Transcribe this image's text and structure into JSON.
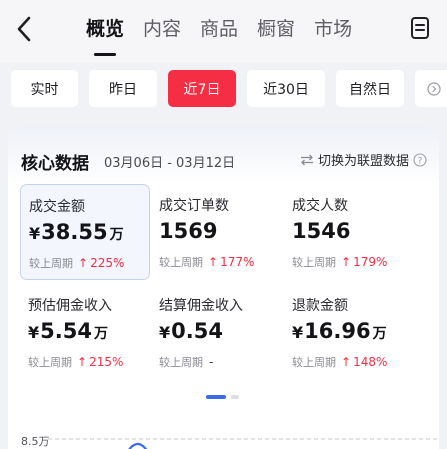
{
  "header": {
    "tabs": [
      {
        "label": "概览",
        "active": true
      },
      {
        "label": "内容",
        "active": false
      },
      {
        "label": "商品",
        "active": false
      },
      {
        "label": "橱窗",
        "active": false
      },
      {
        "label": "市场",
        "active": false
      }
    ]
  },
  "date_chips": [
    {
      "label": "实时"
    },
    {
      "label": "昨日"
    },
    {
      "label": "近7日",
      "active": true
    },
    {
      "label": "近30日"
    },
    {
      "label": "自然日"
    }
  ],
  "core": {
    "title": "核心数据",
    "range": "03月06日 - 03月12日",
    "switch_label": "切换为联盟数据"
  },
  "metrics": [
    {
      "label": "成交金额",
      "currency": "¥",
      "value": "38.55",
      "unit": "万",
      "compare_label": "较上周期",
      "arrow": "↑",
      "change": "225%",
      "selected": true
    },
    {
      "label": "成交订单数",
      "currency": "",
      "value": "1569",
      "unit": "",
      "compare_label": "较上周期",
      "arrow": "↑",
      "change": "177%"
    },
    {
      "label": "成交人数",
      "currency": "",
      "value": "1546",
      "unit": "",
      "compare_label": "较上周期",
      "arrow": "↑",
      "change": "179%"
    },
    {
      "label": "预估佣金收入",
      "currency": "¥",
      "value": "5.54",
      "unit": "万",
      "compare_label": "较上周期",
      "arrow": "↑",
      "change": "215%"
    },
    {
      "label": "结算佣金收入",
      "currency": "¥",
      "value": "0.54",
      "unit": "",
      "compare_label": "较上周期",
      "arrow": "",
      "change": "-"
    },
    {
      "label": "退款金额",
      "currency": "¥",
      "value": "16.96",
      "unit": "万",
      "compare_label": "较上周期",
      "arrow": "↑",
      "change": "148%"
    }
  ],
  "chart": {
    "gridline_label": "8.5万",
    "accent": "#3b6cf0"
  },
  "colors": {
    "accent_red": "#f52e44",
    "accent_blue": "#3b6cf0"
  }
}
